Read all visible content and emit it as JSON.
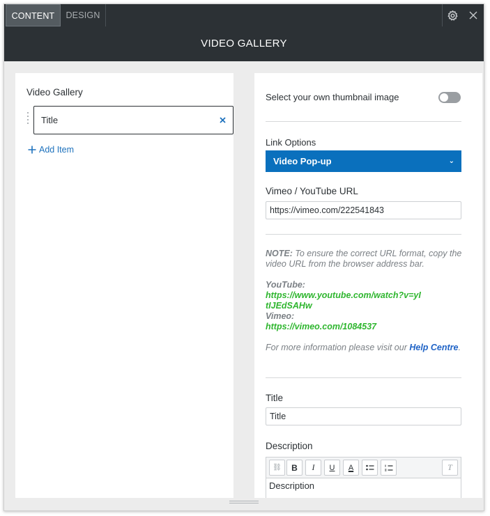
{
  "tabs": [
    {
      "label": "CONTENT",
      "active": true
    },
    {
      "label": "DESIGN",
      "active": false
    }
  ],
  "icons": {
    "settings": "gear-icon",
    "close": "close-icon"
  },
  "header": {
    "title": "VIDEO GALLERY"
  },
  "left": {
    "section_label": "Video Gallery",
    "items": [
      {
        "label": "Title"
      }
    ],
    "add_item_label": "Add Item"
  },
  "right": {
    "thumbnail_toggle_label": "Select your own thumbnail image",
    "thumbnail_toggle_on": false,
    "link_options_label": "Link Options",
    "link_options_value": "Video Pop-up",
    "url_label": "Vimeo / YouTube URL",
    "url_value": "https://vimeo.com/222541843",
    "note": {
      "prefix": "NOTE:",
      "text": " To ensure the correct URL format, copy the video URL from the browser address bar.",
      "youtube_label": "YouTube:",
      "youtube_url": "https://www.youtube.com/watch?v=yItIJEdSAHw",
      "vimeo_label": "Vimeo:",
      "vimeo_url": "https://vimeo.com/1084537",
      "more_info": "For more information please visit our ",
      "help_link": "Help Centre",
      "period": "."
    },
    "title_label": "Title",
    "title_value": "Title",
    "description_label": "Description",
    "description_value": "Description"
  },
  "colors": {
    "header_bg": "#2c3135",
    "accent_blue": "#0a70bd",
    "link_green": "#2fb62f",
    "help_link_blue": "#1f63c6"
  }
}
